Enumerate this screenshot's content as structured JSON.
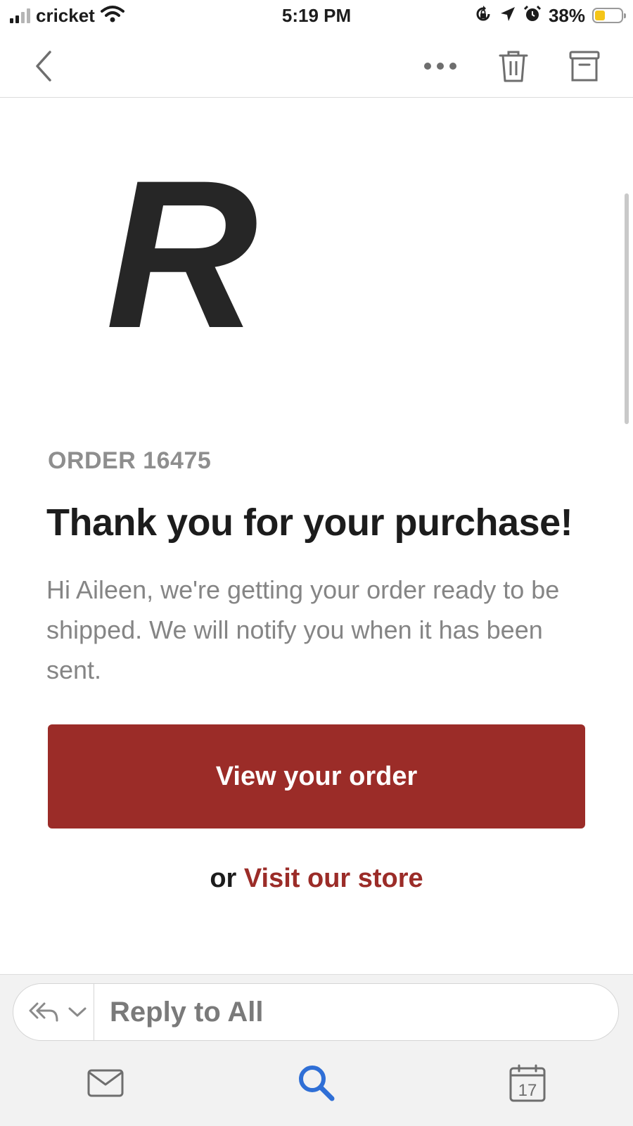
{
  "status_bar": {
    "carrier": "cricket",
    "time": "5:19 PM",
    "battery_percent": "38%",
    "battery_level": 0.38,
    "icons": [
      "signal-icon",
      "wifi-icon",
      "rotation-lock-icon",
      "location-icon",
      "alarm-icon",
      "battery-icon"
    ]
  },
  "toolbar": {
    "icons": [
      "back-chevron-icon",
      "more-icon",
      "trash-icon",
      "archive-icon"
    ]
  },
  "email": {
    "logo_letter": "R",
    "order_number": "ORDER 16475",
    "headline": "Thank you for your purchase!",
    "body": "Hi Aileen, we're getting your order ready to be shipped. We will notify you when it has been sent.",
    "cta_label": "View your order",
    "alt_prefix": "or",
    "alt_link": "Visit our store"
  },
  "reply_bar": {
    "label": "Reply to All",
    "icons": [
      "reply-all-icon",
      "chevron-down-icon"
    ]
  },
  "tab_bar": {
    "calendar_day": "17",
    "icons": [
      "mail-icon",
      "search-icon",
      "calendar-icon"
    ]
  },
  "colors": {
    "accent": "#9b2c28",
    "search_blue": "#2f6fd6",
    "battery_fill": "#f5c518"
  }
}
